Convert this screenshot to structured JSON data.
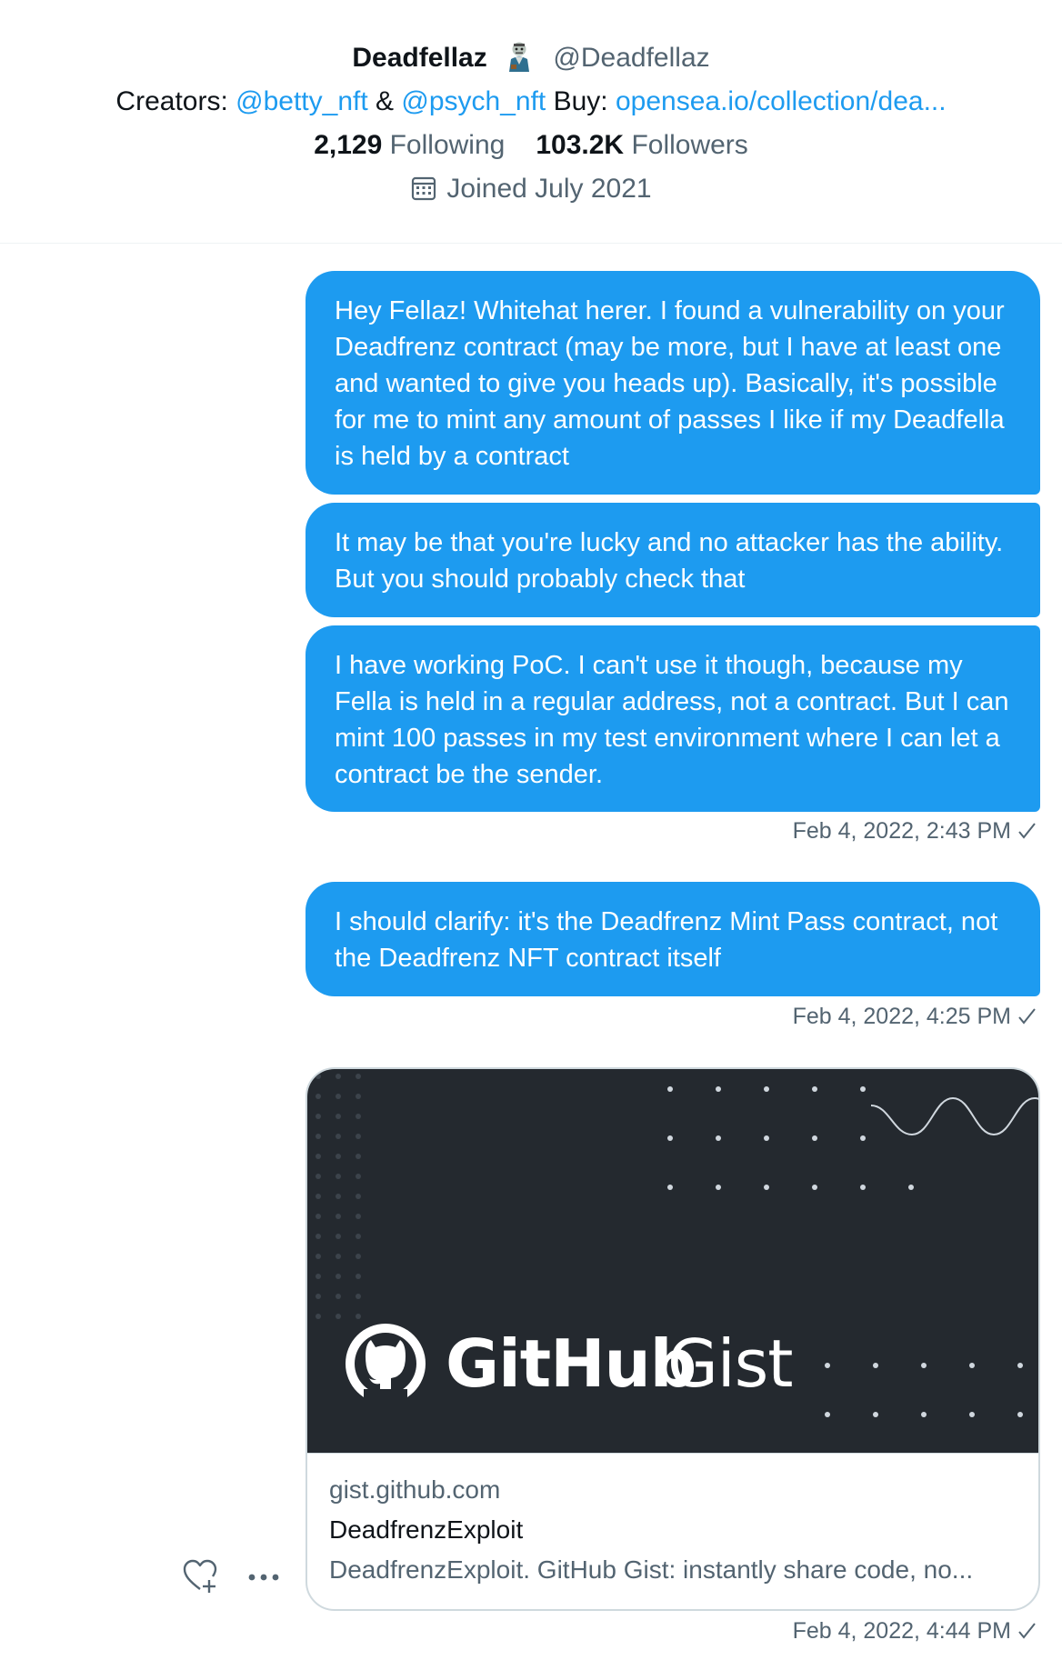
{
  "profile": {
    "display_name": "Deadfellaz",
    "avatar_emoji_icon": "zombie-emoji-icon",
    "handle": "@Deadfellaz",
    "bio": {
      "creators_prefix": "Creators:",
      "creator1": "@betty_nft",
      "amp": "&",
      "creator2": "@psych_nft",
      "buy_prefix": "Buy:",
      "buy_link": "opensea.io/collection/dea..."
    },
    "following_count": "2,129",
    "following_label": "Following",
    "followers_count": "103.2K",
    "followers_label": "Followers",
    "joined": "Joined July 2021",
    "joined_icon": "calendar-icon"
  },
  "messages": [
    {
      "text": "Hey Fellaz! Whitehat herer. I found a vulnerability on your Deadfrenz contract (may be more, but I have at least one and wanted to give you heads up). Basically, it's possible for me to mint any amount of passes I like if my Deadfella is held by a contract"
    },
    {
      "text": "It may be that you're lucky and no attacker has the ability. But you should probably check that"
    },
    {
      "text": "I have working PoC. I can't use it though, because my Fella is held in a regular address, not a contract. But I can mint 100 passes in my test environment where I can let a contract be the sender."
    },
    {
      "text": "I should clarify: it's the Deadfrenz Mint Pass contract, not the Deadfrenz NFT contract itself"
    }
  ],
  "timestamps": {
    "group1": "Feb 4, 2022, 2:43 PM",
    "group2": "Feb 4, 2022, 4:25 PM",
    "group3": "Feb 4, 2022, 4:44 PM"
  },
  "link_card": {
    "image_text_bold": "GitHub",
    "image_text_light": "Gist",
    "domain": "gist.github.com",
    "title": "DeadfrenzExploit",
    "description": "DeadfrenzExploit. GitHub Gist: instantly share code, no..."
  },
  "actions": {
    "react_icon": "heart-plus-icon",
    "more_icon": "more-icon"
  },
  "colors": {
    "accent": "#1d9bf0",
    "muted_text": "#536471",
    "card_dark": "#24292f"
  }
}
